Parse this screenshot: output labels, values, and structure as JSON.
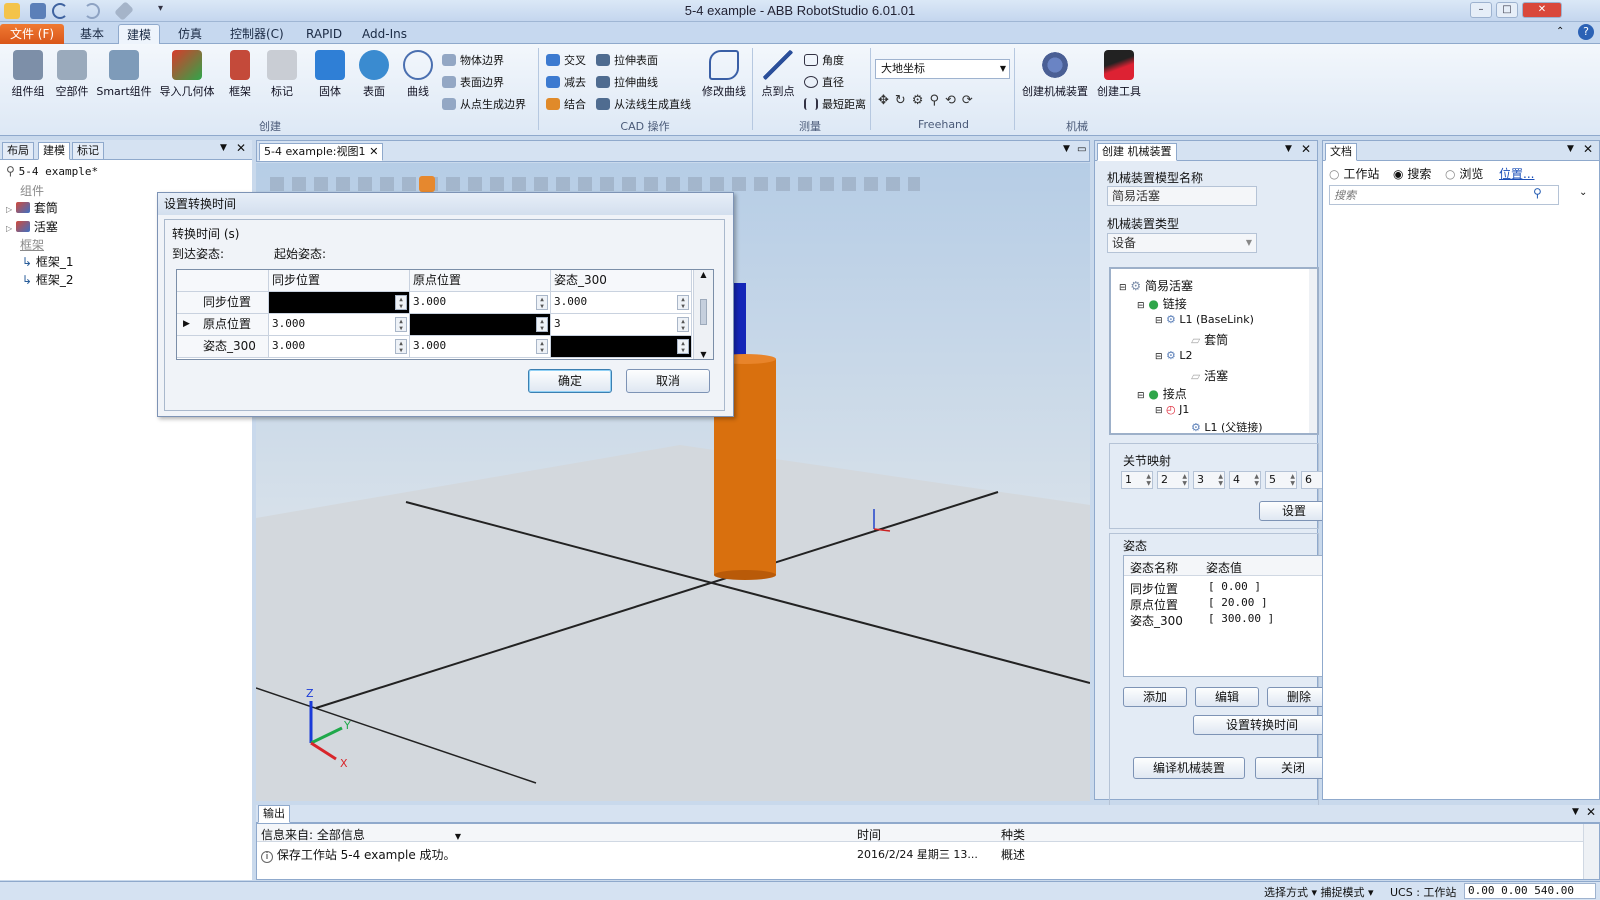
{
  "window": {
    "title": "5-4 example - ABB RobotStudio 6.01.01"
  },
  "ribbon_tabs": [
    "文件 (F)",
    "基本",
    "建模",
    "仿真",
    "控制器(C)",
    "RAPID",
    "Add-Ins"
  ],
  "ribbon": {
    "create": {
      "label": "创建",
      "items": [
        "组件组",
        "空部件",
        "Smart组件",
        "导入几何体",
        "框架",
        "标记",
        "固体",
        "表面",
        "曲线"
      ],
      "small": [
        "物体边界",
        "表面边界",
        "从点生成边界"
      ]
    },
    "cad": {
      "label": "CAD 操作",
      "small": [
        "交叉",
        "减去",
        "结合",
        "拉伸表面",
        "拉伸曲线",
        "从法线生成直线"
      ],
      "modify": "修改曲线"
    },
    "measure": {
      "label": "测量",
      "point": "点到点",
      "small": [
        "角度",
        "直径",
        "最短距离"
      ]
    },
    "freehand": {
      "label": "Freehand",
      "coord": "大地坐标"
    },
    "mech": {
      "label": "机械",
      "items": [
        "创建机械装置",
        "创建工具"
      ]
    }
  },
  "left": {
    "tabs": [
      "布局",
      "建模",
      "标记"
    ],
    "station": "5-4 example*",
    "components_label": "组件",
    "components": [
      "套筒",
      "活塞"
    ],
    "frames_label": "框架",
    "frames": [
      "框架_1",
      "框架_2"
    ]
  },
  "viewport": {
    "tab": "5-4 example:视图1"
  },
  "dialog": {
    "title": "设置转换时间",
    "section": "转换时间 (s)",
    "to_label": "到达姿态:",
    "from_label": "起始姿态:",
    "columns": [
      "同步位置",
      "原点位置",
      "姿态_300"
    ],
    "rows": [
      {
        "name": "同步位置",
        "cells": [
          "",
          "3.000",
          "3.000"
        ]
      },
      {
        "name": "原点位置",
        "cells": [
          "3.000",
          "",
          "3"
        ]
      },
      {
        "name": "姿态_300",
        "cells": [
          "3.000",
          "3.000",
          ""
        ]
      }
    ],
    "ok": "确定",
    "cancel": "取消"
  },
  "mech": {
    "tab": "创建 机械装置",
    "model_name_label": "机械装置模型名称",
    "model_name": "简易活塞",
    "type_label": "机械装置类型",
    "type": "设备",
    "tree": {
      "root": "简易活塞",
      "links": "链接",
      "l1": "L1 (BaseLink)",
      "l1c": "套筒",
      "l2": "L2",
      "l2c": "活塞",
      "joints": "接点",
      "j1": "J1",
      "j1c": "L1 (父链接)"
    },
    "joint_map_label": "关节映射",
    "joint_nums": [
      "1",
      "2",
      "3",
      "4",
      "5",
      "6"
    ],
    "set": "设置",
    "pose_label": "姿态",
    "pose_cols": [
      "姿态名称",
      "姿态值"
    ],
    "poses": [
      {
        "name": "同步位置",
        "value": "[ 0.00 ]"
      },
      {
        "name": "原点位置",
        "value": "[ 20.00 ]"
      },
      {
        "name": "姿态_300",
        "value": "[ 300.00 ]"
      }
    ],
    "add": "添加",
    "edit": "编辑",
    "delete": "删除",
    "set_time": "设置转换时间",
    "compile": "编译机械装置",
    "close": "关闭"
  },
  "docs": {
    "tab": "文档",
    "radio": [
      "工作站",
      "搜索",
      "浏览"
    ],
    "link": "位置...",
    "search_placeholder": "搜索"
  },
  "output": {
    "tab": "输出",
    "source": "信息来自: 全部信息",
    "time_col": "时间",
    "type_col": "种类",
    "message": "保存工作站 5-4 example 成功。",
    "time": "2016/2/24 星期三 13...",
    "type": "概述"
  },
  "status": {
    "select": "选择方式 ▾ 捕捉模式 ▾",
    "ucs": "UCS : 工作站",
    "coords": "0.00  0.00  540.00"
  },
  "colors": {
    "accent": "#e8641e",
    "cylinder": "#d9700e",
    "rod": "#1626b8"
  }
}
